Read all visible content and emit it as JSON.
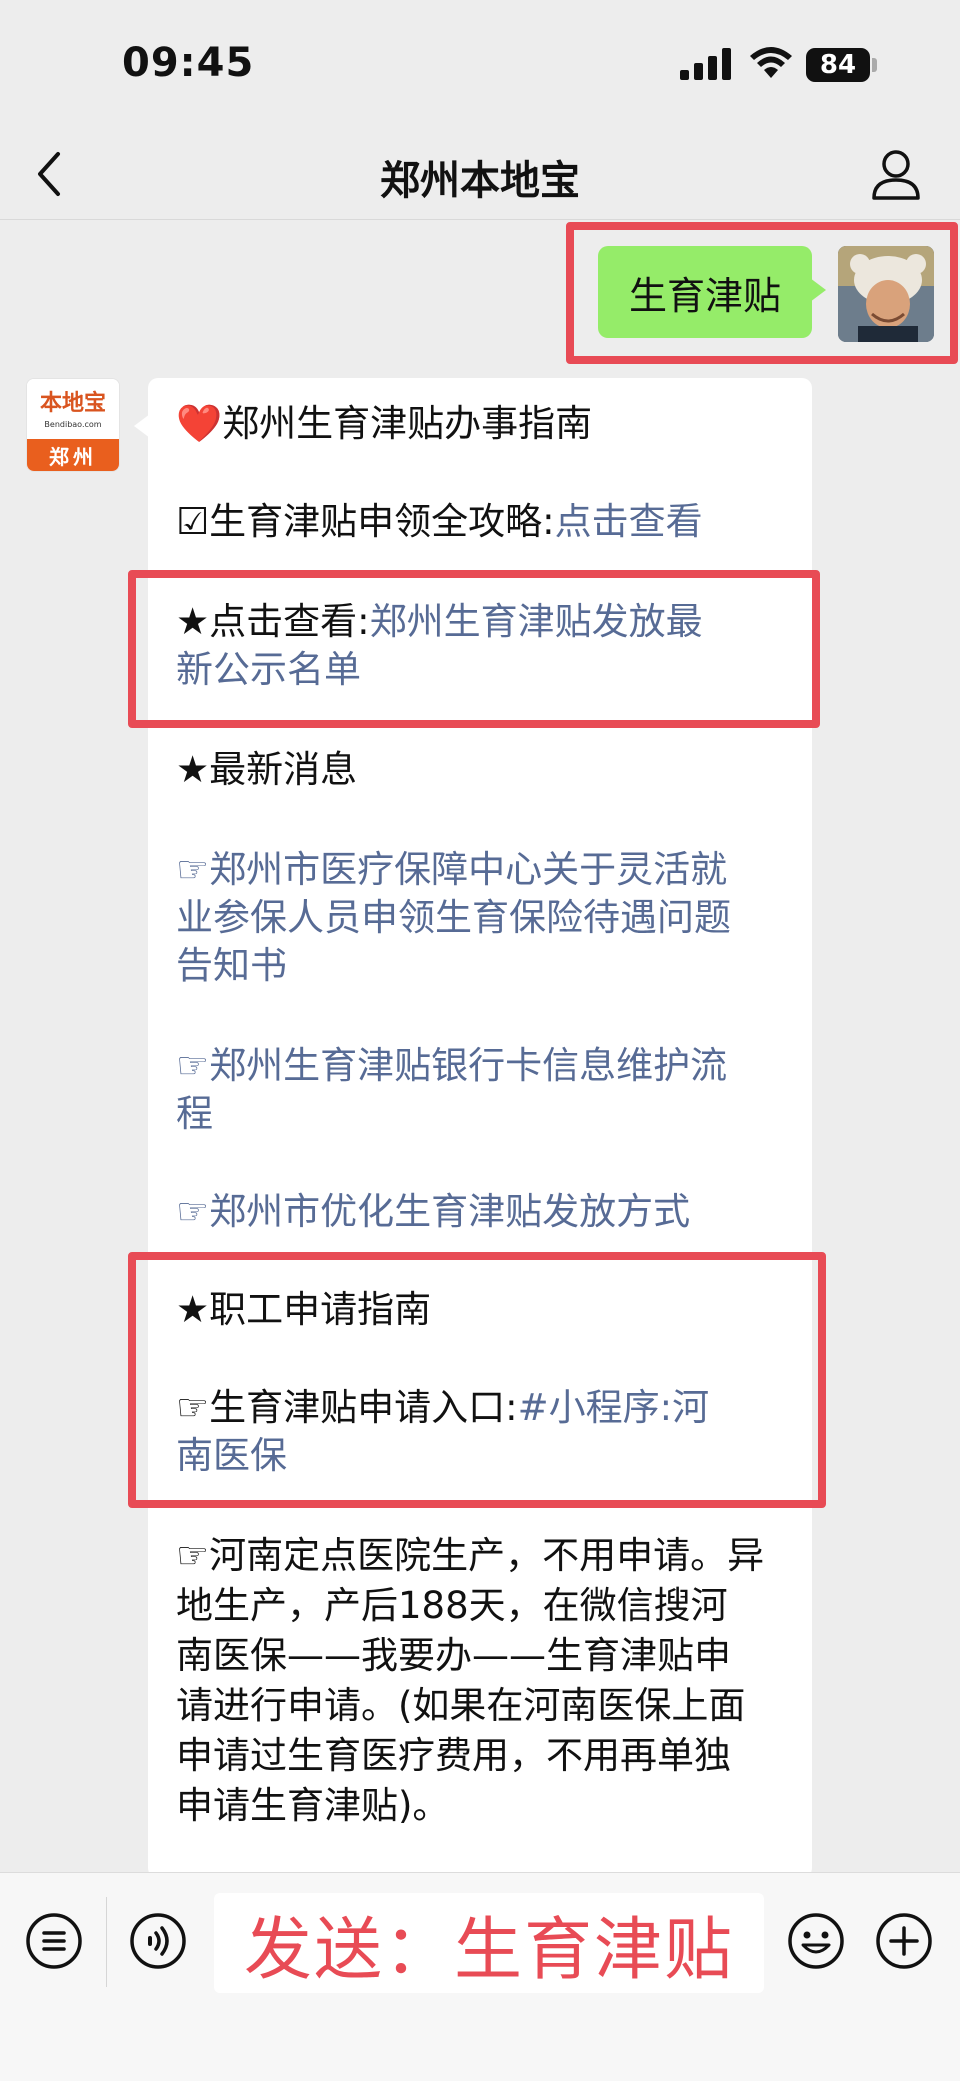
{
  "status_bar": {
    "time": "09:45",
    "battery": "84"
  },
  "nav": {
    "title": "郑州本地宝"
  },
  "user_message": {
    "text": "生育津贴"
  },
  "bot": {
    "avatar_text": "本地宝",
    "avatar_url": "Bendibao.com",
    "avatar_city": "郑州",
    "heading_emoji": "❤️",
    "heading": "郑州生育津贴办事指南",
    "line1_prefix": "☑生育津贴申领全攻略:",
    "line1_link": "点击查看",
    "line2_prefix": "★点击查看:",
    "line2_link_a": "郑州生育津贴发放最",
    "line2_link_b": "新公示名单",
    "section_news": "★最新消息",
    "news1_a": "郑州市医疗保障中心关于灵活就",
    "news1_b": "业参保人员申领生育保险待遇问题",
    "news1_c": "告知书",
    "news2_a": "郑州生育津贴银行卡信息维护流",
    "news2_b": "程",
    "news3": "郑州市优化生育津贴发放方式",
    "pointer": "☞",
    "section_guide": "★职工申请指南",
    "guide_prefix": "☞生育津贴申请入口:",
    "guide_link_a": "#小程序:河",
    "guide_link_b": "南医保",
    "note_lines": [
      "☞河南定点医院生产，不用申请。异",
      "地生产，产后188天，在微信搜河",
      "南医保——我要办——生育津贴申",
      "请进行申请。(如果在河南医保上面",
      "申请过生育医疗费用，不用再单独",
      "申请生育津贴)。"
    ]
  },
  "input": {
    "overlay_text": "发送：生育津贴"
  },
  "colors": {
    "highlight": "#e84b55",
    "link": "#576b95",
    "user_bubble": "#95ec69"
  },
  "icons": [
    "back-icon",
    "profile-icon",
    "menu-icon",
    "voice-icon",
    "emoji-icon",
    "plus-icon"
  ]
}
